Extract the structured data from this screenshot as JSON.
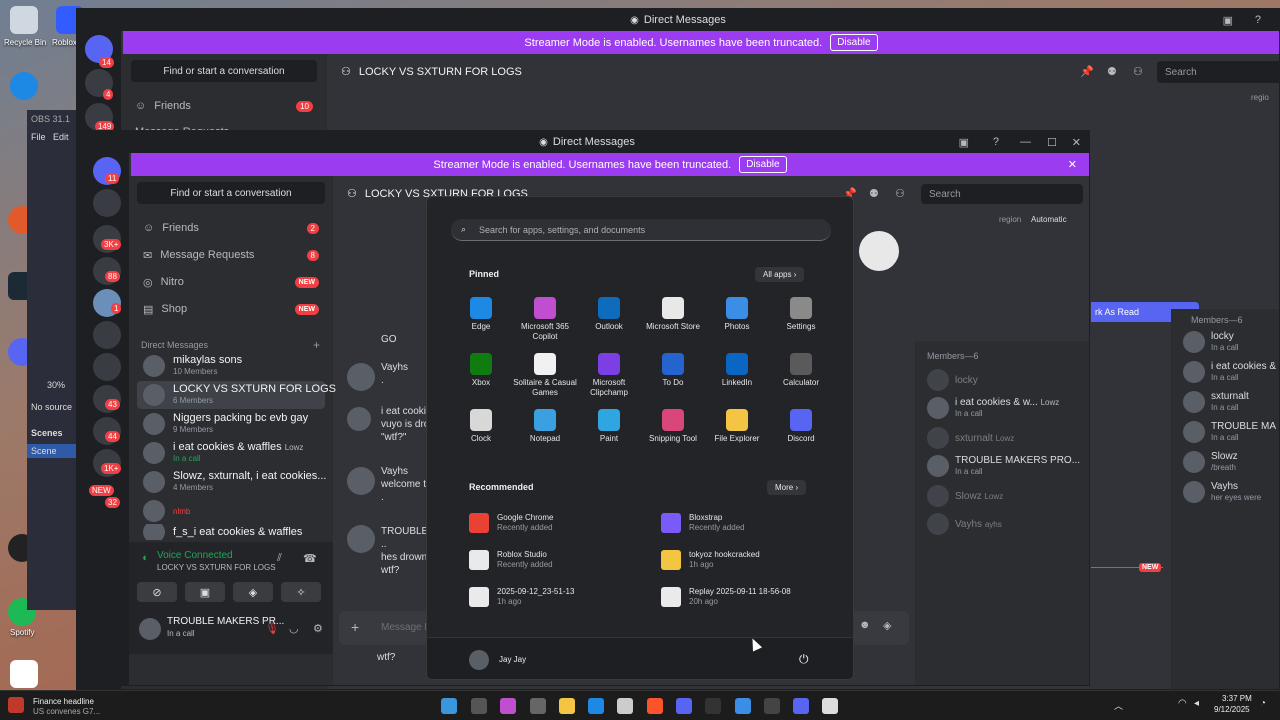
{
  "desktop": {
    "icons": [
      "Recycle Bin",
      "Roblox",
      "Microsoft Edge",
      "Clownfish",
      "Logitech",
      "Discord",
      "OBS Studio",
      "Legacy",
      "Spotify"
    ]
  },
  "obs": {
    "version": "OBS 31.1",
    "menu_file": "File",
    "menu_edit": "Edit",
    "zoom": "30%",
    "no_source": "No source",
    "scenes_header": "Scenes",
    "scene_item": "Scene"
  },
  "back_window": {
    "title": "Direct Messages",
    "banner_text": "Streamer Mode is enabled. Usernames have been truncated.",
    "banner_button": "Disable",
    "search_conv": "Find or start a conversation",
    "friends_label": "Friends",
    "friends_badge": "10",
    "message_requests": "Message Requests",
    "channel_title": "LOCKY VS SXTURN FOR LOGS",
    "search_placeholder": "Search",
    "region_label": "regio",
    "mark_read": "rk As Read",
    "new_label": "NEW",
    "members_header": "Members—6",
    "members": [
      {
        "name": "locky",
        "status": "In a call"
      },
      {
        "name": "i eat cookies &",
        "status": "In a call"
      },
      {
        "name": "sxturnalt",
        "status": "In a call"
      },
      {
        "name": "TROUBLE MA",
        "status": "In a call"
      },
      {
        "name": "Slowz",
        "status": "/breath"
      },
      {
        "name": "Vayhs",
        "status": "her eyes were"
      }
    ],
    "guild_badges": [
      "14",
      "4",
      "149"
    ]
  },
  "front_window": {
    "title": "Direct Messages",
    "banner_text": "Streamer Mode is enabled. Usernames have been truncated.",
    "banner_button": "Disable",
    "search_conv": "Find or start a conversation",
    "nav": {
      "friends": "Friends",
      "friends_badge": "2",
      "requests": "Message Requests",
      "requests_badge": "8",
      "nitro": "Nitro",
      "nitro_badge": "NEW",
      "shop": "Shop",
      "shop_badge": "NEW"
    },
    "dm_header": "Direct Messages",
    "dm_add": "+",
    "dms": [
      {
        "name": "mikaylas sons",
        "sub": "10 Members"
      },
      {
        "name": "LOCKY VS SXTURN FOR LOGS",
        "sub": "6 Members"
      },
      {
        "name": "Niggers packing bc evb gay",
        "sub": "9 Members"
      },
      {
        "name": "i eat cookies & waffles",
        "tag": "Lowz",
        "sub": "In a call"
      },
      {
        "name": "Slowz, sxturnalt, i eat cookies...",
        "sub": "4 Members"
      },
      {
        "name": "",
        "tag": "nlmb",
        "sub": ""
      },
      {
        "name": "f_s_i eat cookies & waffles",
        "sub": ""
      }
    ],
    "guild_badges": [
      "11",
      "3K+",
      "88",
      "1",
      "43",
      "44",
      "1K+",
      "NEW",
      "32"
    ],
    "voice": {
      "status": "Voice Connected",
      "channel": "LOCKY VS SXTURN FOR LOGS"
    },
    "user": {
      "name": "TROUBLE MAKERS PR...",
      "status": "In a call"
    },
    "channel_title": "LOCKY VS SXTURN FOR LOGS",
    "search_placeholder": "Search",
    "region_label": "region",
    "region_value": "Automatic",
    "messages": [
      {
        "author": "",
        "lines": [
          "GO"
        ]
      },
      {
        "author": "Vayhs",
        "lines": [
          "."
        ]
      },
      {
        "author": "",
        "lines": [
          "i eat cooki",
          "vuyo is dro",
          "\"wtf?\""
        ]
      },
      {
        "author": "Vayhs",
        "lines": [
          "welcome t",
          "."
        ]
      },
      {
        "author": "TROUBLE",
        "lines": [
          "..",
          "hes drown",
          "wtf?"
        ]
      }
    ],
    "message_placeholder": "Message L",
    "under_text": "wtf?",
    "members_header": "Members—6",
    "members": [
      {
        "name": "locky",
        "tag": "",
        "status": ""
      },
      {
        "name": "i eat cookies & w...",
        "tag": "Lowz",
        "status": "In a call"
      },
      {
        "name": "sxturnalt",
        "tag": "Lowz",
        "status": ""
      },
      {
        "name": "TROUBLE MAKERS PRO...",
        "tag": "",
        "status": "In a call"
      },
      {
        "name": "Slowz",
        "tag": "Lowz",
        "status": ""
      },
      {
        "name": "Vayhs",
        "tag": "ayhs",
        "status": ""
      }
    ]
  },
  "start_menu": {
    "search_placeholder": "Search for apps, settings, and documents",
    "pinned_label": "Pinned",
    "all_apps": "All apps",
    "pinned": [
      {
        "label": "Edge",
        "icon": "edge-icon",
        "color": "#1e88e5"
      },
      {
        "label": "Microsoft 365 Copilot",
        "icon": "copilot-icon",
        "color": "#c04fcf"
      },
      {
        "label": "Outlook",
        "icon": "outlook-icon",
        "color": "#0f6cbd"
      },
      {
        "label": "Microsoft Store",
        "icon": "store-icon",
        "color": "#e8e8e8"
      },
      {
        "label": "Photos",
        "icon": "photos-icon",
        "color": "#3a8ee6"
      },
      {
        "label": "Settings",
        "icon": "gear-icon",
        "color": "#8a8a8a"
      },
      {
        "label": "Xbox",
        "icon": "xbox-icon",
        "color": "#107c10"
      },
      {
        "label": "Solitaire & Casual Games",
        "icon": "solitaire-icon",
        "color": "#f1f1f1"
      },
      {
        "label": "Microsoft Clipchamp",
        "icon": "clipchamp-icon",
        "color": "#7b3fe4"
      },
      {
        "label": "To Do",
        "icon": "todo-icon",
        "color": "#2564cf"
      },
      {
        "label": "LinkedIn",
        "icon": "linkedin-icon",
        "color": "#0a66c2"
      },
      {
        "label": "Calculator",
        "icon": "calculator-icon",
        "color": "#5a5a5a"
      },
      {
        "label": "Clock",
        "icon": "clock-icon",
        "color": "#d8d8d8"
      },
      {
        "label": "Notepad",
        "icon": "notepad-icon",
        "color": "#3aa0e0"
      },
      {
        "label": "Paint",
        "icon": "paint-icon",
        "color": "#2fa6e0"
      },
      {
        "label": "Snipping Tool",
        "icon": "snipping-icon",
        "color": "#d9467a"
      },
      {
        "label": "File Explorer",
        "icon": "folder-icon",
        "color": "#f4c542"
      },
      {
        "label": "Discord",
        "icon": "discord-icon",
        "color": "#5865f2"
      }
    ],
    "recommended_label": "Recommended",
    "more_button": "More",
    "recommended": [
      {
        "name": "Google Chrome",
        "sub": "Recently added",
        "icon": "chrome-icon",
        "color": "#e94235"
      },
      {
        "name": "Bloxstrap",
        "sub": "Recently added",
        "icon": "bloxstrap-icon",
        "color": "#7a5af8"
      },
      {
        "name": "Roblox Studio",
        "sub": "Recently added",
        "icon": "roblox-studio-icon",
        "color": "#eaeaea"
      },
      {
        "name": "tokyoz hookcracked",
        "sub": "1h ago",
        "icon": "folder-icon",
        "color": "#f4c542"
      },
      {
        "name": "2025-09-12_23-51-13",
        "sub": "1h ago",
        "icon": "video-file-icon",
        "color": "#eaeaea"
      },
      {
        "name": "Replay 2025-09-11 18-56-08",
        "sub": "20h ago",
        "icon": "video-file-icon",
        "color": "#eaeaea"
      }
    ],
    "user_name": "Jay Jay"
  },
  "taskbar": {
    "news_title": "Finance headline",
    "news_sub": "US convenes G7...",
    "time": "3:37 PM",
    "date": "9/12/2025"
  }
}
